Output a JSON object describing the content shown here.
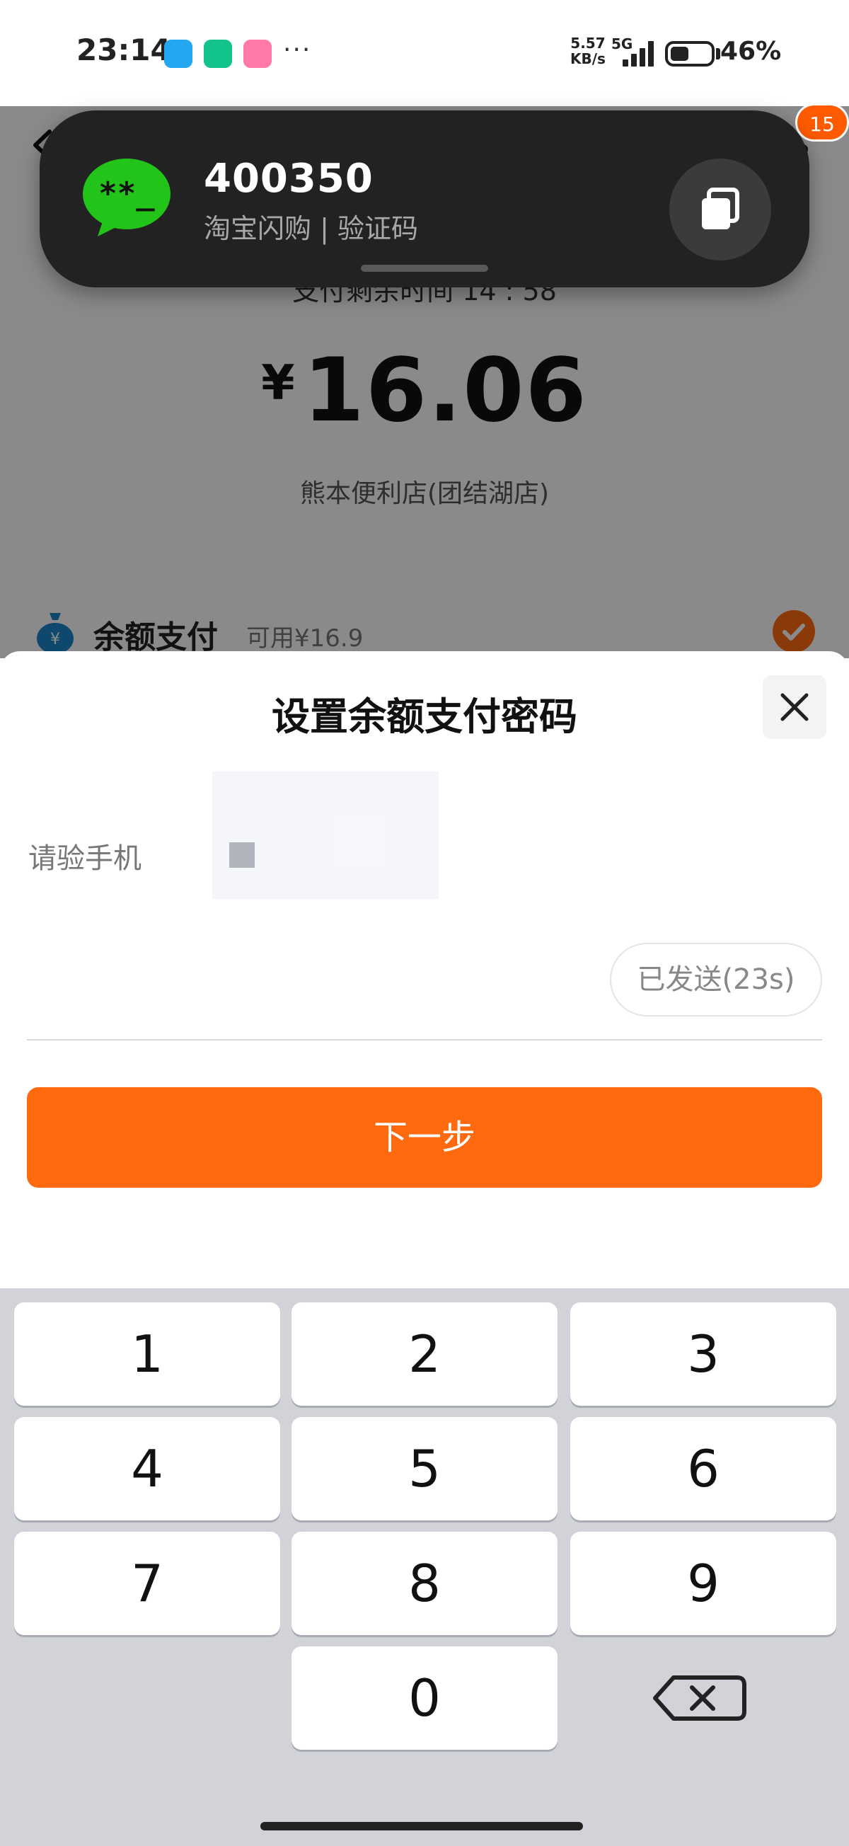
{
  "status_bar": {
    "time": "23:14",
    "more": "···",
    "net_speed_value": "5.57",
    "net_speed_unit": "KB/s",
    "network": "5G",
    "battery_percent": "46%",
    "battery_level": 0.46
  },
  "background_page": {
    "pay_remaining": "支付剩余时间 14 : 58",
    "currency": "¥",
    "amount": "16.06",
    "store_name": "熊本便利店(团结湖店)",
    "balance_label": "余额支付",
    "balance_available": "可用¥16.9",
    "notification_badge": "15"
  },
  "notification": {
    "code": "400350",
    "subtitle": "淘宝闪购 | 验证码",
    "icon": "sms-code-icon",
    "icon_text": "**_"
  },
  "sheet": {
    "title": "设置余额支付密码",
    "verify_label": "请验手机",
    "resend_label": "已发送(23s)",
    "next_label": "下一步"
  },
  "keypad": {
    "keys": [
      "1",
      "2",
      "3",
      "4",
      "5",
      "6",
      "7",
      "8",
      "9",
      "0"
    ],
    "delete_icon": "backspace-icon"
  },
  "colors": {
    "accent": "#ff6a0f",
    "notif_bg": "#222222",
    "sms_green": "#22c41a",
    "keypad_bg": "#d1d3d9"
  }
}
